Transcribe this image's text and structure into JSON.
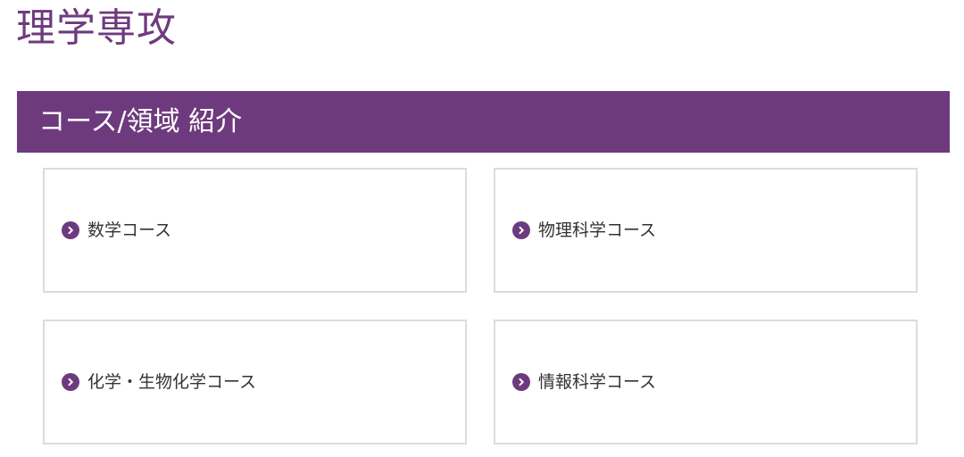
{
  "page": {
    "title": "理学専攻"
  },
  "section": {
    "heading": "コース/領域 紹介"
  },
  "courses": [
    {
      "label": "数学コース",
      "icon": "chevron-right-circle-icon"
    },
    {
      "label": "物理科学コース",
      "icon": "chevron-right-circle-icon"
    },
    {
      "label": "化学・生物化学コース",
      "icon": "chevron-right-circle-icon"
    },
    {
      "label": "情報科学コース",
      "icon": "chevron-right-circle-icon"
    }
  ],
  "colors": {
    "accent": "#6e3a7e",
    "card_border": "#dcdcdc",
    "text": "#333333",
    "banner_text": "#ffffff"
  }
}
